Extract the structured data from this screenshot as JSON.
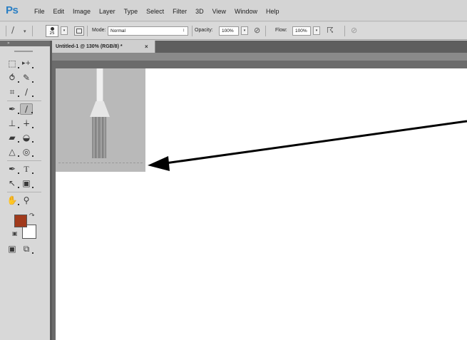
{
  "app": {
    "logo": "Ps"
  },
  "menu": [
    "File",
    "Edit",
    "Image",
    "Layer",
    "Type",
    "Select",
    "Filter",
    "3D",
    "View",
    "Window",
    "Help"
  ],
  "options": {
    "brush_size": "25",
    "mode_label": "Mode:",
    "mode_value": "Normal",
    "opacity_label": "Opacity:",
    "opacity_value": "100%",
    "flow_label": "Flow:",
    "flow_value": "100%"
  },
  "document": {
    "tab_title": "Untitled-1 @ 130% (RGB/8) *",
    "close_glyph": "×"
  },
  "colors": {
    "foreground": "#a13a1c",
    "background": "#ffffff",
    "logo": "#2a7fc4"
  },
  "tools": [
    "rectangular-marquee-icon",
    "move-icon",
    "lasso-icon",
    "quick-selection-icon",
    "crop-icon",
    "eyedropper-icon",
    "spot-healing-icon",
    "brush-icon",
    "clone-stamp-icon",
    "history-brush-icon",
    "eraser-icon",
    "paint-bucket-icon",
    "blur-icon",
    "dodge-icon",
    "pen-icon",
    "type-icon",
    "path-selection-icon",
    "shape-icon",
    "hand-icon",
    "zoom-icon",
    "quick-mask-icon",
    "screen-mode-icon"
  ],
  "active_tool": "brush-icon"
}
